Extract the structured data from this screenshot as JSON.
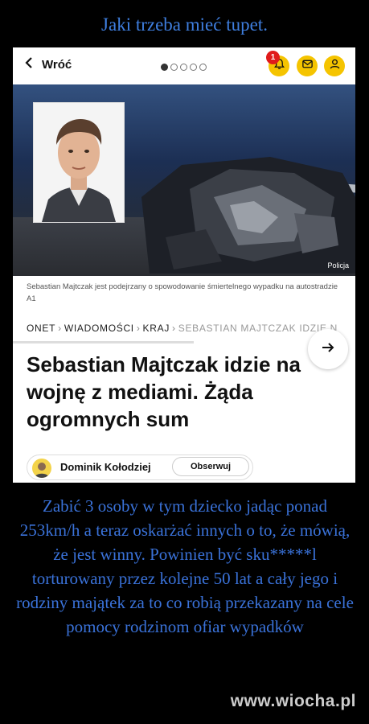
{
  "meme": {
    "title": "Jaki trzeba mieć tupet.",
    "body": "Zabić 3 osoby w tym dziecko jadąc ponad 253km/h a teraz oskarżać innych o to, że mówią, że jest winny. Powinien być sku*****l torturowany przez kolejne 50 lat a cały jego i rodziny  majątek za to co robią przekazany na cele pomocy rodzinom ofiar wypadków",
    "watermark": "www.wiocha.pl"
  },
  "app": {
    "back_label": "Wróć",
    "notification_count": "1",
    "photo_credit": "Policja",
    "photo_caption": "Sebastian Majtczak jest podejrzany o spowodowanie śmiertelnego wypadku na autostradzie A1",
    "breadcrumbs": [
      "ONET",
      "WIADOMOŚCI",
      "KRAJ",
      "SEBASTIAN MAJTCZAK IDZIE N"
    ],
    "headline": "Sebastian Majtczak idzie na wojnę z mediami. Żąda ogromnych sum",
    "author": "Dominik Kołodziej",
    "follow_label": "Obserwuj",
    "pagination": {
      "total": 5,
      "active": 1
    }
  },
  "colors": {
    "accent": "#f5c400",
    "badge": "#e01b1b",
    "meme_text": "#3a72d9"
  },
  "icons": [
    "chevron-left-icon",
    "bell-icon",
    "mail-icon",
    "user-icon",
    "arrow-right-icon"
  ]
}
